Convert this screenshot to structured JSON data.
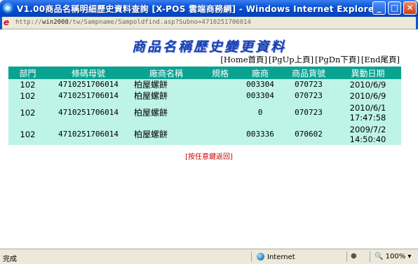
{
  "window": {
    "title": "V1.00商品名稱明細歷史資料查詢 [X-POS 雲端商務網] - Windows Internet Explorer",
    "minimize": "_",
    "maximize": "□",
    "close": "✕"
  },
  "address": {
    "url_prefix": "http://",
    "url_host": "win2008",
    "url_path": "/tw/Sampname/Sampoldfind.asp?Subno=4710251706014"
  },
  "page": {
    "title": "商品名稱歷史變更資料",
    "nav": [
      "[Home首頁]",
      "[PgUp上頁]",
      "[PgDn下頁]",
      "[End尾頁]"
    ],
    "back": "[按任意鍵返回]"
  },
  "table": {
    "headers": [
      "部門",
      "條碼母號",
      "廠商名稱",
      "規格",
      "廠商",
      "商品貨號",
      "異動日期"
    ],
    "rows": [
      {
        "dept": "102",
        "barcode": "4710251706014",
        "name": "柏屋螺餅",
        "spec": "",
        "vendor": "003304",
        "item": "070723",
        "date1": "2010/6/9",
        "date2": ""
      },
      {
        "dept": "102",
        "barcode": "4710251706014",
        "name": "柏屋螺餅",
        "spec": "",
        "vendor": "003304",
        "item": "070723",
        "date1": "2010/6/9",
        "date2": ""
      },
      {
        "dept": "102",
        "barcode": "4710251706014",
        "name": "柏屋螺餅",
        "spec": "",
        "vendor": "0",
        "item": "070723",
        "date1": "2010/6/1",
        "date2": "17:47:58"
      },
      {
        "dept": "102",
        "barcode": "4710251706014",
        "name": "柏屋螺餅",
        "spec": "",
        "vendor": "003336",
        "item": "070602",
        "date1": "2009/7/2",
        "date2": "14:50:40"
      }
    ]
  },
  "status": {
    "text": "完成",
    "zone": "Internet",
    "zoom": "100%"
  },
  "icons": {
    "app": "ie-icon",
    "page": "page-icon",
    "zone": "globe-icon"
  },
  "colors": {
    "header_bg": "#0aa391",
    "row_bg": "#bdf4e7",
    "title": "#1a3fb0",
    "back_link": "#cc0000"
  }
}
